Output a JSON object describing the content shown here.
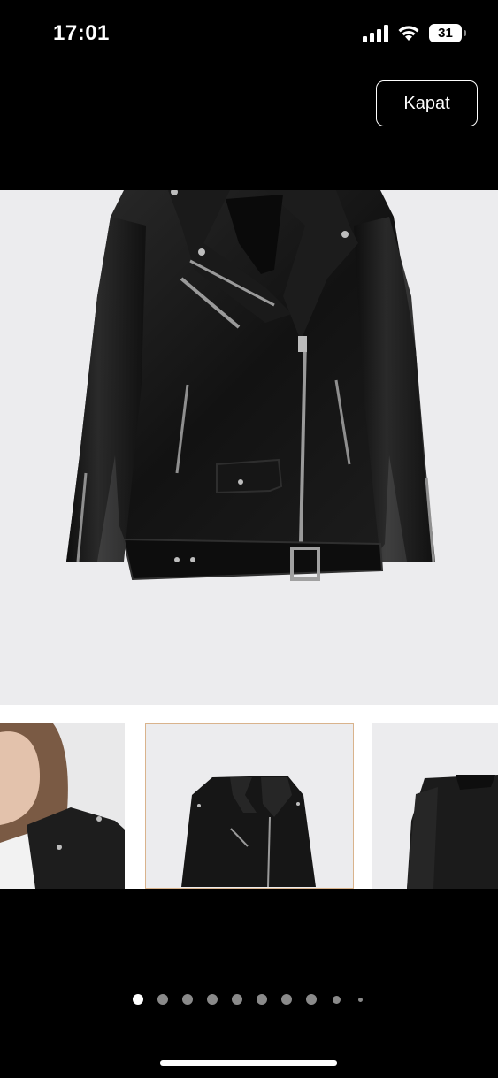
{
  "status_bar": {
    "time": "17:01",
    "battery_level": "31",
    "signal_icon": "cellular-signal-icon",
    "wifi_icon": "wifi-icon",
    "battery_icon": "battery-icon"
  },
  "header": {
    "close_label": "Kapat"
  },
  "gallery": {
    "main_image": "black-leather-biker-jacket-front",
    "thumbnails": [
      {
        "image": "model-wearing-jacket",
        "selected": false
      },
      {
        "image": "black-leather-biker-jacket-front",
        "selected": true
      },
      {
        "image": "black-leather-biker-jacket-back",
        "selected": false
      }
    ],
    "page_count": 10,
    "active_page": 1
  },
  "colors": {
    "background": "#000000",
    "image_background": "#ececee",
    "thumbnail_selected_border": "#d9b38c",
    "dot_active": "#ffffff",
    "dot_inactive": "#8a8a8a"
  }
}
